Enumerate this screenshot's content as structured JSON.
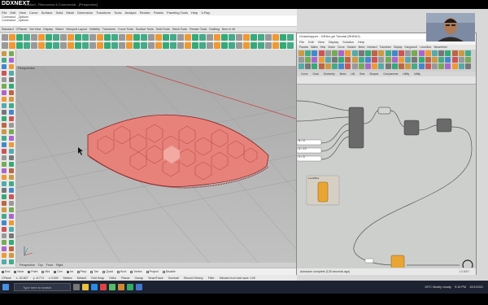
{
  "logo": "DDXNEXT",
  "rhino": {
    "title": "Untitled - Rhinoceros 6 Commercial - [Perspective]",
    "menu": [
      "File",
      "Edit",
      "View",
      "Curve",
      "Surface",
      "Solid",
      "Mesh",
      "Dimension",
      "Transform",
      "Tools",
      "Analyze",
      "Render",
      "Panels",
      "Paneling Tools",
      "Help",
      "V-Ray"
    ],
    "command_history": [
      "Command: _Options",
      "Command: _Options"
    ],
    "toolbar_tabs": [
      "Standard",
      "CPlanes",
      "Set View",
      "Display",
      "Select",
      "Viewport Layout",
      "Visibility",
      "Transform",
      "Curve Tools",
      "Surface Tools",
      "Solid Tools",
      "Mesh Tools",
      "Render Tools",
      "Drafting",
      "New in V6"
    ],
    "viewport_label": "Perspective",
    "viewport_tabs": [
      "Perspective",
      "Top",
      "Front",
      "Right"
    ],
    "osnaps": [
      {
        "label": "End",
        "on": true
      },
      {
        "label": "Near",
        "on": true
      },
      {
        "label": "Point",
        "on": true
      },
      {
        "label": "Mid",
        "on": false
      },
      {
        "label": "Cen",
        "on": true
      },
      {
        "label": "Int",
        "on": true
      },
      {
        "label": "Perp",
        "on": false
      },
      {
        "label": "Tan",
        "on": false
      },
      {
        "label": "Quad",
        "on": false
      },
      {
        "label": "Knot",
        "on": false
      },
      {
        "label": "Vertex",
        "on": false
      },
      {
        "label": "Project",
        "on": false
      },
      {
        "label": "Disable",
        "on": false
      }
    ],
    "status": [
      "CPlane",
      "x -32.827",
      "y -8.774",
      "z 0.000",
      "Meters",
      "Default",
      "Grid Snap",
      "Ortho",
      "Planar",
      "Osnap",
      "SmartTrack",
      "Gumball",
      "Record History",
      "Filter",
      "Minutes from last save: 128"
    ]
  },
  "grasshopper": {
    "title": "Grasshopper - 03Hex.gh Tutorial (RHINO)",
    "menu": [
      "File",
      "Edit",
      "View",
      "Display",
      "Solution",
      "Help"
    ],
    "tabs": [
      "Params",
      "Maths",
      "Sets",
      "Vector",
      "Curve",
      "Surface",
      "Mesh",
      "Intersect",
      "Transform",
      "Display",
      "Kangaroo2",
      "LunchBox",
      "Weaverbird"
    ],
    "categories": [
      "Curve",
      "Grad",
      "Geometry",
      "Mesh",
      "Util",
      "Sets",
      "Shapes",
      "Components",
      "Utility",
      "Utility"
    ],
    "zoom": "100%",
    "status": "Autosave complete (125 seconds ago)",
    "version": "1.0.0007",
    "panel_title": "Geometry",
    "nodes": [
      "Hex",
      "Pop2D",
      "LunchBox",
      "Hex Cell",
      "Kang",
      "Mesh",
      "List Item",
      "Panel"
    ],
    "sliders": [
      "N = 6",
      "U = 10",
      "V = 5"
    ]
  },
  "taskbar": {
    "search": "Type here to search",
    "weather": "25°C Mostly cloudy",
    "time": "9:16 PM",
    "date": "10/1/2021"
  },
  "colors": {
    "surface": "#e7827b",
    "grasshopper_node": "#e9a534",
    "taskbar": "#1c2230"
  }
}
